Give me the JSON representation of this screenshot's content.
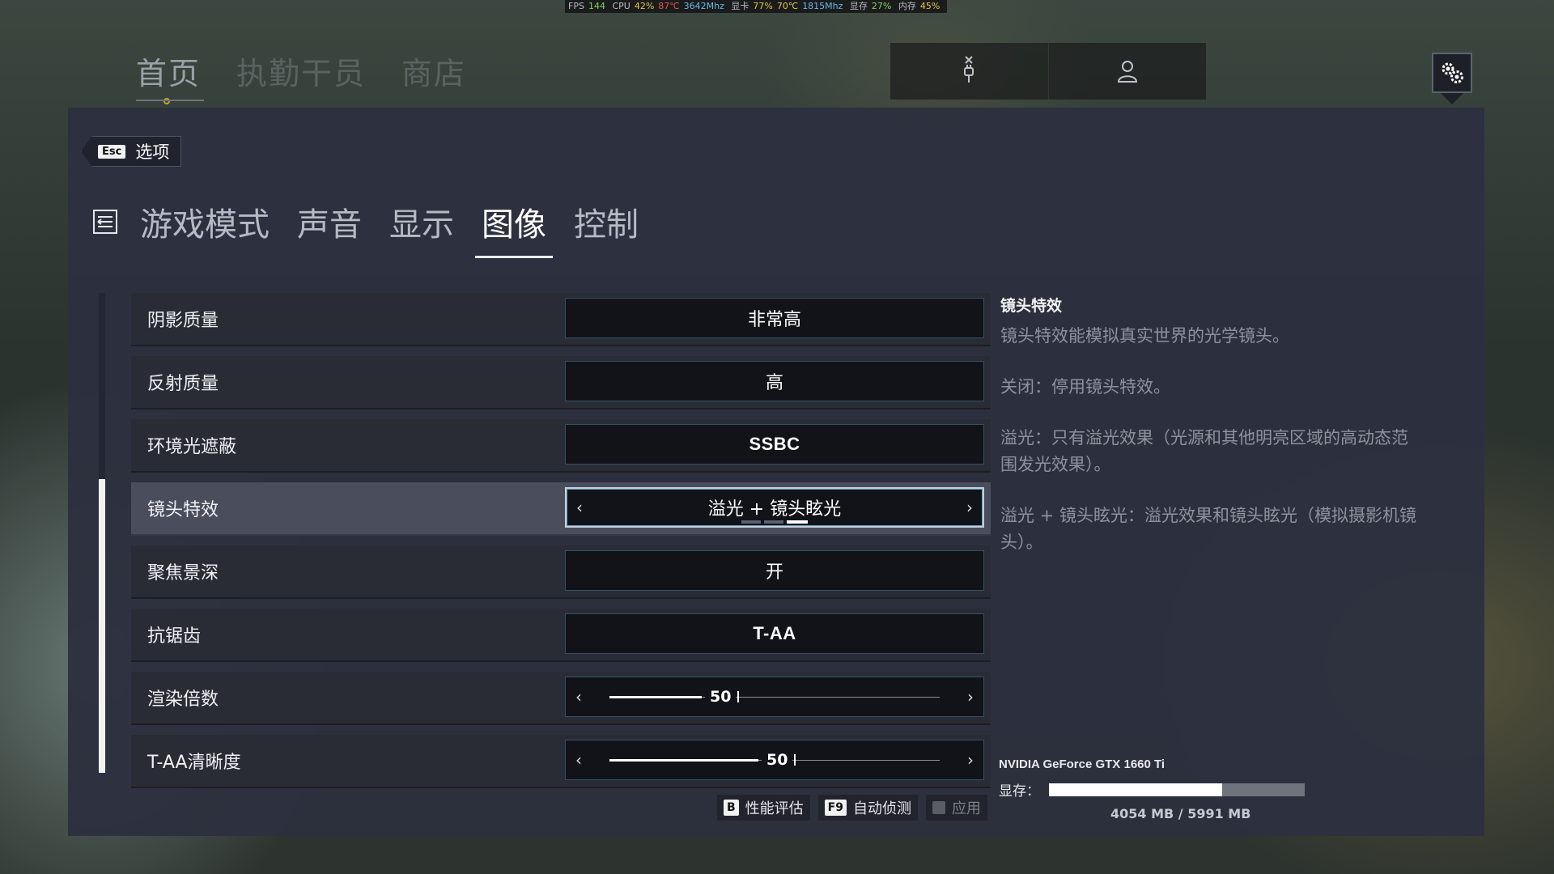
{
  "hud": {
    "fps_label": "FPS",
    "fps": "144",
    "cpu_label": "CPU",
    "cpu_usage": "42%",
    "cpu_temp": "87℃",
    "cpu_clock": "3642Mhz",
    "gpu_label": "显卡",
    "gpu_usage": "77%",
    "gpu_temp": "70℃",
    "gpu_clock": "1815Mhz",
    "vram_label": "显存",
    "vram_usage": "27%",
    "mem_label": "内存",
    "mem_usage": "45%"
  },
  "top_nav": {
    "items": [
      "首页",
      "执勤干员",
      "商店"
    ],
    "active_index": 0
  },
  "back": {
    "key": "Esc",
    "label": "选项"
  },
  "tabs": {
    "items": [
      "游戏模式",
      "声音",
      "显示",
      "图像",
      "控制"
    ],
    "active_index": 3
  },
  "settings": [
    {
      "label": "阴影质量",
      "value": "非常高",
      "type": "select"
    },
    {
      "label": "反射质量",
      "value": "高",
      "type": "select"
    },
    {
      "label": "环境光遮蔽",
      "value": "SSBC",
      "type": "select"
    },
    {
      "label": "镜头特效",
      "value": "溢光 + 镜头眩光",
      "type": "select",
      "selected": true,
      "option_count": 3,
      "option_index": 2
    },
    {
      "label": "聚焦景深",
      "value": "开",
      "type": "select"
    },
    {
      "label": "抗锯齿",
      "value": "T-AA",
      "type": "select"
    },
    {
      "label": "渲染倍数",
      "value": "50",
      "type": "slider",
      "fraction": 0.28
    },
    {
      "label": "T-AA清晰度",
      "value": "50",
      "type": "slider",
      "fraction": 0.45
    }
  ],
  "footer": {
    "benchmark_key": "B",
    "benchmark_label": "性能评估",
    "autodetect_key": "F9",
    "autodetect_label": "自动侦测",
    "apply_label": "应用"
  },
  "description": {
    "title": "镜头特效",
    "paragraphs": [
      "镜头特效能模拟真实世界的光学镜头。",
      "关闭：停用镜头特效。",
      "溢光：只有溢光效果（光源和其他明亮区域的高动态范围发光效果）。",
      "溢光 + 镜头眩光：溢光效果和镜头眩光（模拟摄影机镜头）。"
    ]
  },
  "gpu": {
    "name": "NVIDIA GeForce GTX 1660 Ti",
    "vram_label": "显存：",
    "vram_text": "4054 MB / 5991 MB",
    "vram_used_fraction": 0.677
  },
  "colors": {
    "panel_bg": "#2d303e",
    "value_border": "#2e5366",
    "accent_gold": "#c9a33a"
  },
  "icons": {
    "plug": "plug-icon",
    "profile": "user-icon",
    "settings": "gear-icon",
    "tabs": "options-list-icon"
  }
}
